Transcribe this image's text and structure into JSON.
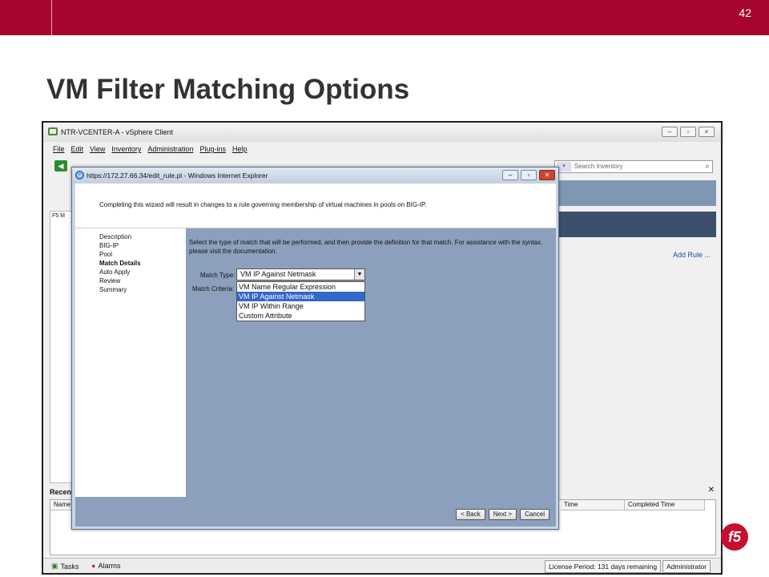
{
  "slide": {
    "number": "42",
    "title": "VM Filter Matching Options"
  },
  "vsphere": {
    "title": "NTR-VCENTER-A - vSphere Client",
    "menu": [
      "File",
      "Edit",
      "View",
      "Inventory",
      "Administration",
      "Plug-ins",
      "Help"
    ],
    "search_placeholder": "Search Inventory",
    "add_rule": "Add Rule ...",
    "left_label": "F5 M",
    "recent_label": "Recen",
    "table_headers": {
      "name": "Name",
      "time": "Time",
      "completed": "Completed Time"
    },
    "status": {
      "tasks": "Tasks",
      "alarms": "Alarms",
      "license": "License Period: 131 days remaining",
      "user": "Administrator"
    }
  },
  "ie": {
    "title": "https://172.27.66.34/edit_rule.pl - Windows Internet Explorer",
    "top_message": "Completing this wizard will result in changes to a rule governing membership of virtual machines in pools on BIG-IP.",
    "steps": [
      "Description",
      "BIG-IP",
      "Pool",
      "Match Details",
      "Auto Apply",
      "Review",
      "Summary"
    ],
    "current_step": "Match Details",
    "instructions": "Select the type of match that will be performed, and then provide the definition for that match. For assistance with the syntax, please visit the documentation.",
    "match_type_label": "Match Type:",
    "match_criteria_label": "Match Criteria:",
    "match_type_value": "VM IP Against Netmask",
    "options": [
      "VM Name Regular Expression",
      "VM IP Against Netmask",
      "VM IP Within Range",
      "Custom Attribute"
    ],
    "selected_option": "VM IP Against Netmask",
    "buttons": {
      "back": "< Back",
      "next": "Next >",
      "cancel": "Cancel"
    }
  },
  "logo": "f5",
  "colors": {
    "brand": "#a6062e",
    "selection": "#3368c9",
    "panel": "#8ca0bd"
  }
}
